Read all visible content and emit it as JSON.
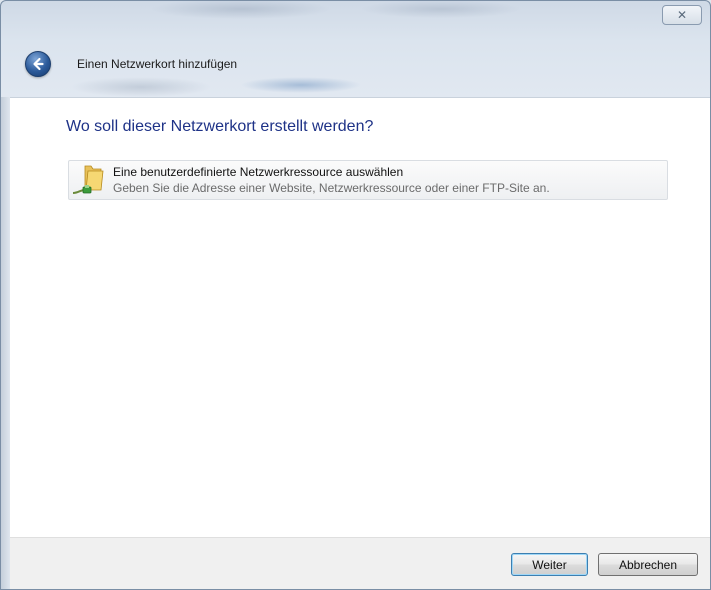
{
  "window": {
    "title": "Einen Netzwerkort hinzufügen",
    "close_glyph": "✕"
  },
  "main": {
    "heading": "Wo soll dieser Netzwerkort erstellt werden?",
    "options": [
      {
        "title": "Eine benutzerdefinierte Netzwerkressource auswählen",
        "description": "Geben Sie die Adresse einer Website, Netzwerkressource oder einer FTP-Site an.",
        "icon": "network-folder-icon"
      }
    ]
  },
  "footer": {
    "next_label": "Weiter",
    "cancel_label": "Abbrechen"
  },
  "colors": {
    "heading": "#1e3287",
    "accent": "#3c7fb1"
  }
}
